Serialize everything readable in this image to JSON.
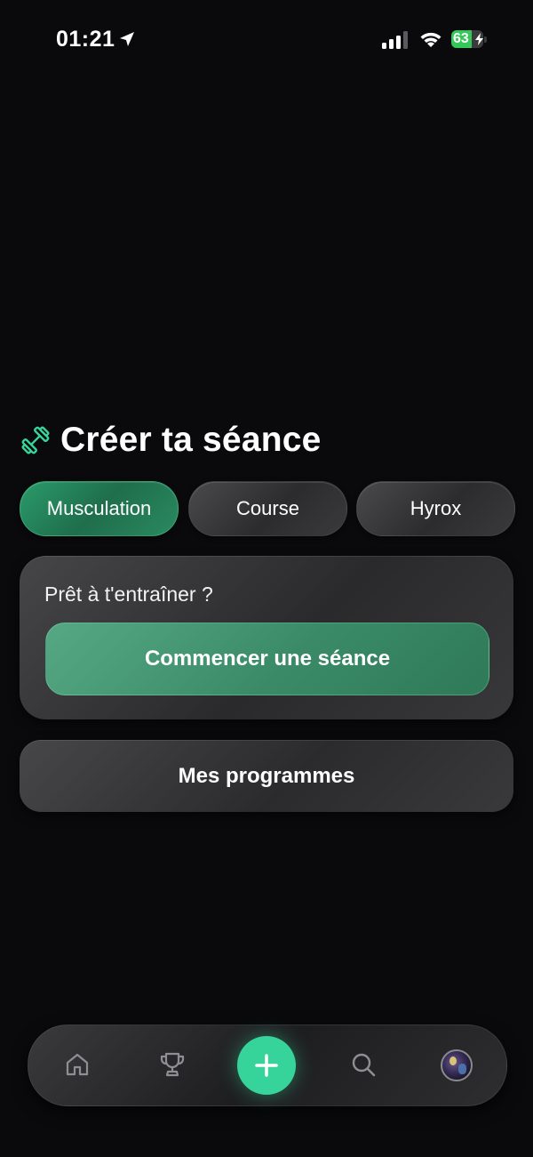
{
  "status_bar": {
    "time": "01:21",
    "battery_level": "63",
    "battery_fraction": 0.63,
    "icons": [
      "location-arrow-icon",
      "cellular-signal-icon",
      "wifi-icon",
      "battery-charging-icon"
    ]
  },
  "header": {
    "icon": "dumbbell-icon",
    "title": "Créer ta séance"
  },
  "tabs": [
    {
      "label": "Musculation",
      "active": true
    },
    {
      "label": "Course",
      "active": false
    },
    {
      "label": "Hyrox",
      "active": false
    }
  ],
  "start_card": {
    "prompt": "Prêt à t'entraîner ?",
    "button_label": "Commencer une séance"
  },
  "programs": {
    "button_label": "Mes programmes"
  },
  "bottom_nav": {
    "items": [
      "home-icon",
      "trophy-icon",
      "add-icon",
      "search-icon",
      "avatar"
    ]
  },
  "colors": {
    "accent": "#36d49b",
    "active_tab": "#1f6e4c",
    "background": "#0a0a0c"
  }
}
